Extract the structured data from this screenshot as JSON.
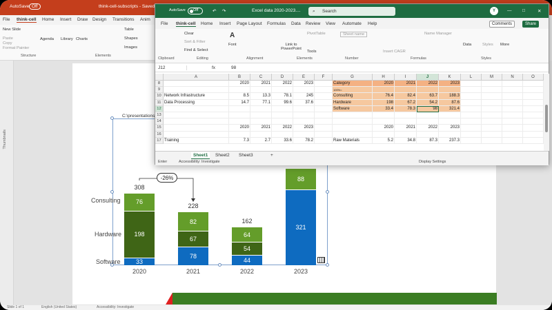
{
  "powerpoint": {
    "autosave": "AutoSave",
    "autosave_state": "Off",
    "title": "think-cell-subscripts - Saved to",
    "tabs": [
      "File",
      "think-cell",
      "Home",
      "Insert",
      "Draw",
      "Design",
      "Transitions",
      "Anim"
    ],
    "ribbon": {
      "new_slide": "New Slide",
      "paste": "Paste",
      "copy": "Copy",
      "format_painter": "Format Painter",
      "agenda": "Agenda",
      "library": "Library",
      "charts": "Charts",
      "table": "Table",
      "shapes": "Shapes",
      "images": "Images",
      "structure": "Structure",
      "elements": "Elements"
    },
    "thumbnails_label": "Thumbnails",
    "status": [
      "Slide 1 of 1",
      "English (United States)",
      "Accessibility: Investigate"
    ]
  },
  "chart_data": {
    "type": "bar",
    "stacked": true,
    "categories": [
      "2020",
      "2021",
      "2022",
      "2023"
    ],
    "series": [
      {
        "name": "Software",
        "values": [
          33,
          78,
          44,
          321
        ]
      },
      {
        "name": "Hardware",
        "values": [
          198,
          67,
          54,
          null
        ]
      },
      {
        "name": "Consulting",
        "values": [
          76,
          82,
          64,
          88
        ]
      }
    ],
    "totals": [
      "308",
      "228",
      "162",
      ""
    ],
    "annotations": [
      {
        "text": "-26%",
        "from": "2020",
        "to": "2021"
      }
    ],
    "path_label": "C:\\presentations\\Excel d",
    "colors": {
      "Consulting": "#649d2a",
      "Hardware": "#3f6516",
      "Software": "#0e6bc0"
    }
  },
  "excel": {
    "autosave": "AutoSave",
    "autosave_state": "Off",
    "title": "Excel data 2020-2023....",
    "search": "Search",
    "user_initial": "Y",
    "tabs": [
      "File",
      "think-cell",
      "Home",
      "Insert",
      "Page Layout",
      "Formulas",
      "Data",
      "Review",
      "View",
      "Automate",
      "Help"
    ],
    "comments": "Comments",
    "share": "Share",
    "ribbon": {
      "clear": "Clear",
      "sort_filter": "Sort & Filter",
      "find_select": "Find & Select",
      "editing": "Editing",
      "font": "Font",
      "alignment": "Alignment",
      "link_to_powerpoint": "Link to PowerPoint",
      "tools": "Tools",
      "elements": "Elements",
      "number": "Number",
      "formulas": "Formulas",
      "data": "Data",
      "styles": "Styles",
      "more": "More",
      "clipboard": "Clipboard",
      "pivot_table": "PivotTable",
      "name_manager": "Name Manager",
      "sheet_name": "Sheet name",
      "insert_cagr": "Insert CAGR"
    },
    "name_box": "J12",
    "formula": "98",
    "columns": [
      "A",
      "B",
      "C",
      "D",
      "E",
      "F",
      "G",
      "H",
      "I",
      "J",
      "K",
      "L",
      "M",
      "N",
      "O"
    ],
    "rows": [
      {
        "num": "8",
        "A": "",
        "B": "2020",
        "C": "2021",
        "D": "2022",
        "E": "2023",
        "G": "Category",
        "H": "2020",
        "I": "2021",
        "J": "2022",
        "K": "2023"
      },
      {
        "num": "9",
        "A": "",
        "B": "",
        "C": "",
        "D": "",
        "E": "",
        "G": "100%=",
        "H": "",
        "I": "",
        "J": "",
        "K": ""
      },
      {
        "num": "10",
        "A": "Network Infrastructure",
        "B": "8.5",
        "C": "13.3",
        "D": "78.1",
        "E": "245",
        "G": "Consulting",
        "H": "76.4",
        "I": "82.4",
        "J": "63.7",
        "K": "188.3"
      },
      {
        "num": "11",
        "A": "Data Processing",
        "B": "14.7",
        "C": "77.1",
        "D": "99.6",
        "E": "37.6",
        "G": "Hardware",
        "H": "198",
        "I": "67.2",
        "J": "54.2",
        "K": "87.6"
      },
      {
        "num": "12",
        "A": "",
        "B": "",
        "C": "",
        "D": "",
        "E": "",
        "G": "Software",
        "H": "33.4",
        "I": "78.3",
        "J": "98",
        "K": "321.4"
      },
      {
        "num": "13",
        "A": "",
        "B": "",
        "C": "",
        "D": "",
        "E": "",
        "G": "",
        "H": "",
        "I": "",
        "J": "",
        "K": ""
      },
      {
        "num": "14",
        "A": "",
        "B": "",
        "C": "",
        "D": "",
        "E": "",
        "G": "",
        "H": "",
        "I": "",
        "J": "",
        "K": ""
      },
      {
        "num": "15",
        "A": "",
        "B": "2020",
        "C": "2021",
        "D": "2022",
        "E": "2023",
        "G": "",
        "H": "2020",
        "I": "2021",
        "J": "2022",
        "K": "2023"
      },
      {
        "num": "16",
        "A": "",
        "B": "",
        "C": "",
        "D": "",
        "E": "",
        "G": "",
        "H": "",
        "I": "",
        "J": "",
        "K": ""
      },
      {
        "num": "17",
        "A": "Training",
        "B": "7.3",
        "C": "2.7",
        "D": "33.6",
        "E": "78.2",
        "G": "Raw Materials",
        "H": "5.2",
        "I": "34.8",
        "J": "87.3",
        "K": "237.3"
      }
    ],
    "sheets": [
      "Sheet1",
      "Sheet2",
      "Sheet3"
    ],
    "add_sheet": "+",
    "status": {
      "mode": "Enter",
      "accessibility": "Accessibility: Investigate",
      "display_settings": "Display Settings"
    }
  }
}
